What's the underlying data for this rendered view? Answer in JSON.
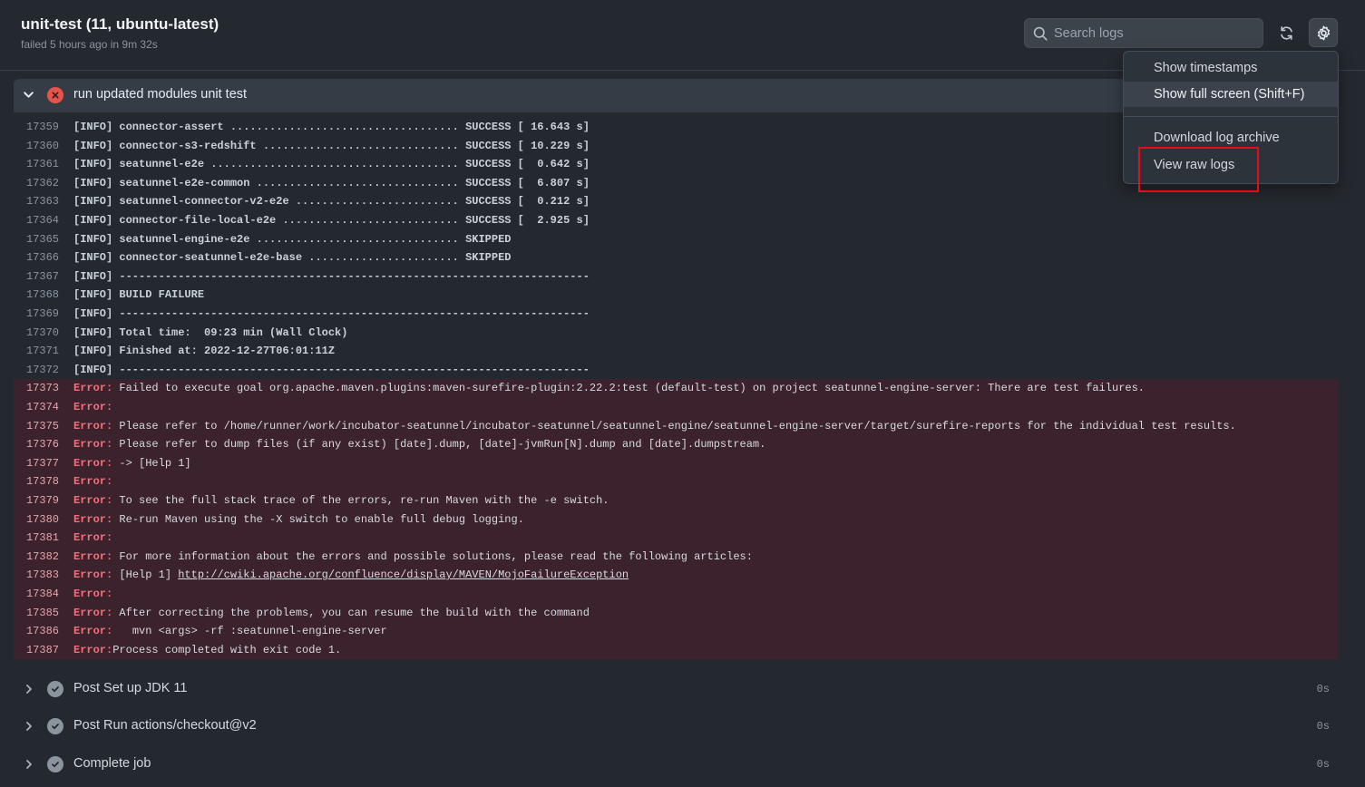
{
  "header": {
    "title": "unit-test (11, ubuntu-latest)",
    "subtitle": "failed 5 hours ago in 9m 32s"
  },
  "search": {
    "placeholder": "Search logs",
    "value": ""
  },
  "settings_menu": {
    "items": [
      {
        "label": "Show timestamps"
      },
      {
        "label": "Show full screen (Shift+F)"
      },
      {
        "label": "Download log archive"
      },
      {
        "label": "View raw logs"
      }
    ]
  },
  "active_step": {
    "title": "run updated modules unit test"
  },
  "log_lines": [
    {
      "num": "17359",
      "text": "[INFO] connector-assert ................................... SUCCESS [ 16.643 s]"
    },
    {
      "num": "17360",
      "text": "[INFO] connector-s3-redshift .............................. SUCCESS [ 10.229 s]"
    },
    {
      "num": "17361",
      "text": "[INFO] seatunnel-e2e ...................................... SUCCESS [  0.642 s]"
    },
    {
      "num": "17362",
      "text": "[INFO] seatunnel-e2e-common ............................... SUCCESS [  6.807 s]"
    },
    {
      "num": "17363",
      "text": "[INFO] seatunnel-connector-v2-e2e ......................... SUCCESS [  0.212 s]"
    },
    {
      "num": "17364",
      "text": "[INFO] connector-file-local-e2e ........................... SUCCESS [  2.925 s]"
    },
    {
      "num": "17365",
      "text": "[INFO] seatunnel-engine-e2e ............................... SKIPPED"
    },
    {
      "num": "17366",
      "text": "[INFO] connector-seatunnel-e2e-base ....................... SKIPPED"
    },
    {
      "num": "17367",
      "text": "[INFO] ------------------------------------------------------------------------"
    },
    {
      "num": "17368",
      "text": "[INFO] BUILD FAILURE"
    },
    {
      "num": "17369",
      "text": "[INFO] ------------------------------------------------------------------------"
    },
    {
      "num": "17370",
      "text": "[INFO] Total time:  09:23 min (Wall Clock)"
    },
    {
      "num": "17371",
      "text": "[INFO] Finished at: 2022-12-27T06:01:11Z"
    },
    {
      "num": "17372",
      "text": "[INFO] ------------------------------------------------------------------------"
    }
  ],
  "error_label": "Error:",
  "error_lines": [
    {
      "num": "17373",
      "text": " Failed to execute goal org.apache.maven.plugins:maven-surefire-plugin:2.22.2:test (default-test) on project seatunnel-engine-server: There are test failures."
    },
    {
      "num": "17374",
      "text": ""
    },
    {
      "num": "17375",
      "text": " Please refer to /home/runner/work/incubator-seatunnel/incubator-seatunnel/seatunnel-engine/seatunnel-engine-server/target/surefire-reports for the individual test results."
    },
    {
      "num": "17376",
      "text": " Please refer to dump files (if any exist) [date].dump, [date]-jvmRun[N].dump and [date].dumpstream."
    },
    {
      "num": "17377",
      "text": " -> [Help 1]"
    },
    {
      "num": "17378",
      "text": ""
    },
    {
      "num": "17379",
      "text": " To see the full stack trace of the errors, re-run Maven with the -e switch."
    },
    {
      "num": "17380",
      "text": " Re-run Maven using the -X switch to enable full debug logging."
    },
    {
      "num": "17381",
      "text": ""
    },
    {
      "num": "17382",
      "text": " For more information about the errors and possible solutions, please read the following articles:"
    },
    {
      "num": "17383",
      "text": " [Help 1] ",
      "link": "http://cwiki.apache.org/confluence/display/MAVEN/MojoFailureException"
    },
    {
      "num": "17384",
      "text": ""
    },
    {
      "num": "17385",
      "text": " After correcting the problems, you can resume the build with the command"
    },
    {
      "num": "17386",
      "text": "   mvn <args> -rf :seatunnel-engine-server"
    },
    {
      "num": "17387",
      "text": "Process completed with exit code 1."
    }
  ],
  "steps": [
    {
      "title": "Post Set up JDK 11",
      "duration": "0s"
    },
    {
      "title": "Post Run actions/checkout@v2",
      "duration": "0s"
    },
    {
      "title": "Complete job",
      "duration": "0s"
    }
  ],
  "colors": {
    "background": "#24292f",
    "error_row": "#3b222c",
    "error_label": "#f0717c",
    "fail_icon": "#e5534b",
    "highlight_box": "#e0101a"
  }
}
